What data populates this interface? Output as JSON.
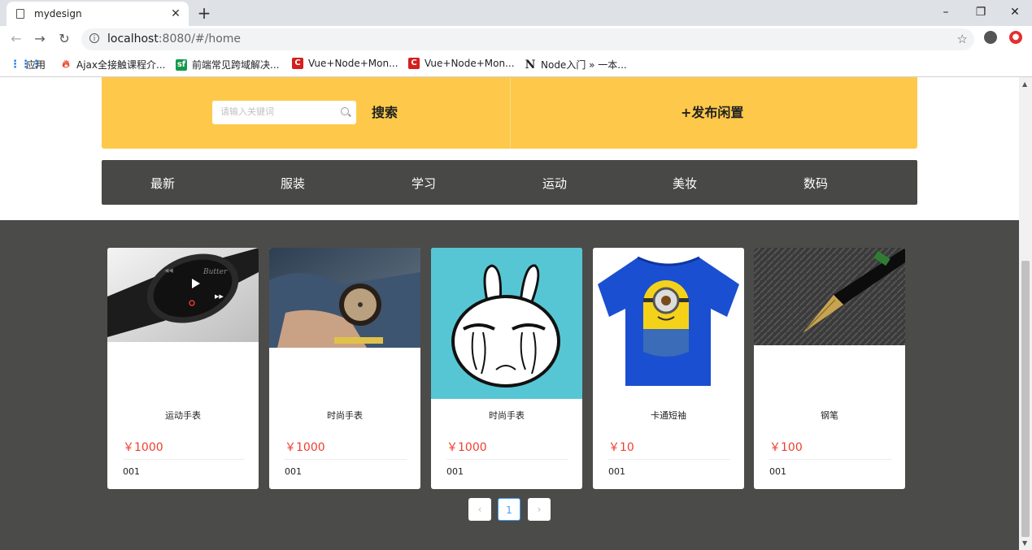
{
  "browser": {
    "tab_title": "mydesign",
    "url_host": "localhost",
    "url_rest": ":8080/#/home",
    "bookmarks": [
      {
        "label": "应用",
        "color": "#1a73e8"
      },
      {
        "label": "Ajax全接触课程介...",
        "color": "#e8452c"
      },
      {
        "label": "前端常见跨域解决...",
        "color": "#129a4a",
        "icon_text": "sf"
      },
      {
        "label": "Vue+Node+Mon...",
        "color": "#d51f1f"
      },
      {
        "label": "Vue+Node+Mon...",
        "color": "#d51f1f"
      },
      {
        "label": "Node入门 » 一本...",
        "color": "#222",
        "icon_text": "N"
      }
    ]
  },
  "header": {
    "search_placeholder": "请输入关键词",
    "search_label": "搜索",
    "publish_label": "+发布闲置"
  },
  "categories": [
    "最新",
    "服装",
    "学习",
    "运动",
    "美妆",
    "数码"
  ],
  "products": [
    {
      "name": "运动手表",
      "price": "￥1000",
      "code": "001",
      "image": "smartwatch"
    },
    {
      "name": "时尚手表",
      "price": "￥1000",
      "code": "001",
      "image": "wristwatch"
    },
    {
      "name": "时尚手表",
      "price": "￥1000",
      "code": "001",
      "image": "crying-rabbit"
    },
    {
      "name": "卡通短袖",
      "price": "￥10",
      "code": "001",
      "image": "minion-tshirt"
    },
    {
      "name": "钢笔",
      "price": "￥100",
      "code": "001",
      "image": "fountain-pen"
    }
  ],
  "pagination": {
    "current": "1",
    "prev": "‹",
    "next": "›"
  },
  "colors": {
    "hero": "#fec94a",
    "nav": "#484846",
    "content_bg": "#4b4b49",
    "price": "#f03e2d",
    "pager_active": "#409eff"
  }
}
